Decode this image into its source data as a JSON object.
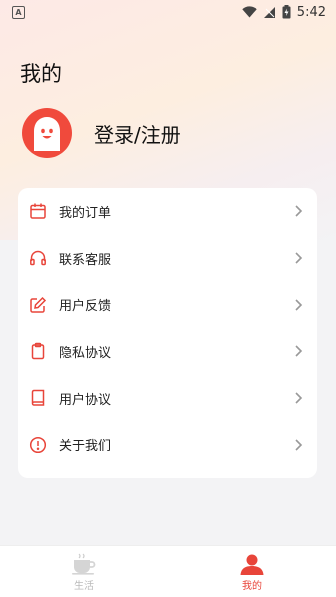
{
  "status_bar": {
    "time": "5:42",
    "notification_icon": "A",
    "icons": [
      "wifi-icon",
      "signal-icon",
      "battery-icon"
    ]
  },
  "page": {
    "title": "我的"
  },
  "profile": {
    "login_label": "登录/注册"
  },
  "menu": {
    "items": [
      {
        "label": "我的订单",
        "icon": "calendar-icon"
      },
      {
        "label": "联系客服",
        "icon": "headphones-icon"
      },
      {
        "label": "用户反馈",
        "icon": "edit-icon"
      },
      {
        "label": "隐私协议",
        "icon": "clipboard-icon"
      },
      {
        "label": "用户协议",
        "icon": "book-icon"
      },
      {
        "label": "关于我们",
        "icon": "info-alert-icon"
      }
    ]
  },
  "tabbar": {
    "tabs": [
      {
        "label": "生活",
        "icon": "coffee-cup-icon",
        "active": false
      },
      {
        "label": "我的",
        "icon": "user-icon",
        "active": true
      }
    ]
  },
  "colors": {
    "accent": "#e8453a",
    "avatar_bg": "#f04a3c",
    "background": "#f3f3f5"
  }
}
